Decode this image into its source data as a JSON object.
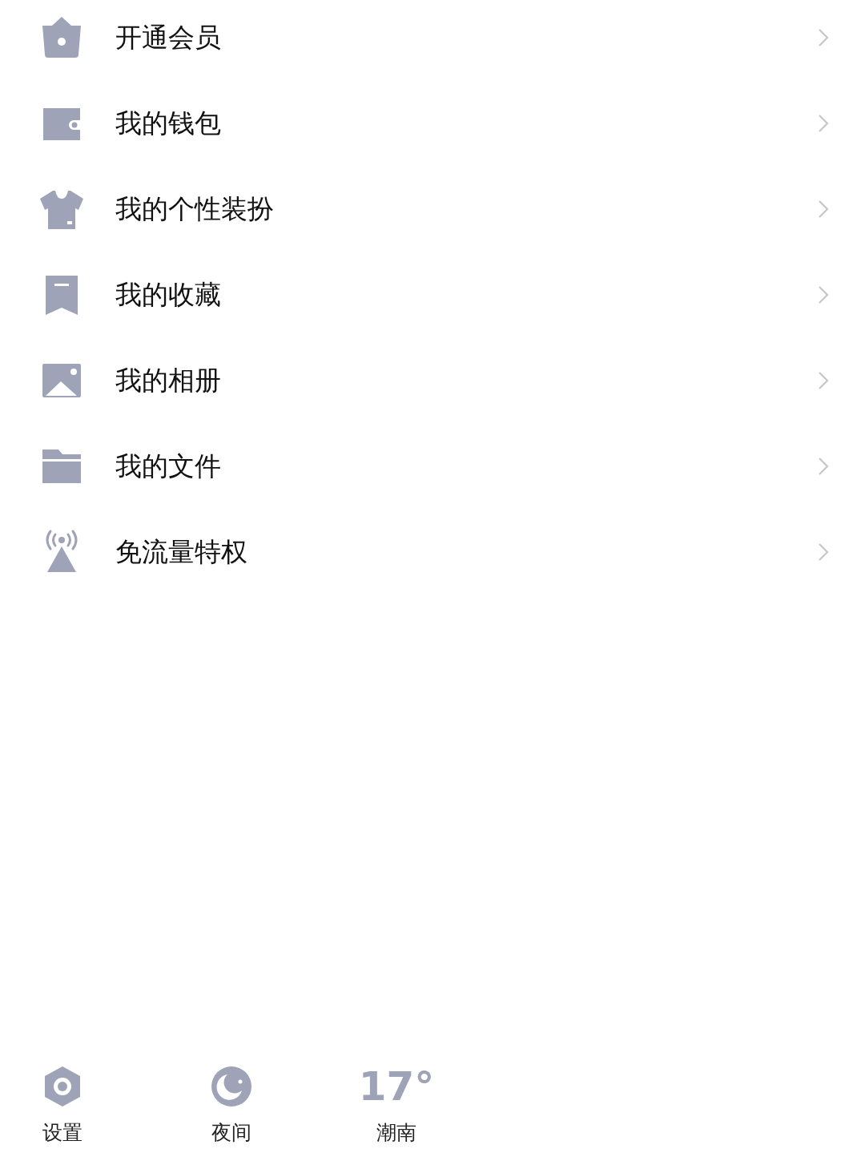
{
  "menu": {
    "items": [
      {
        "kind": "crown",
        "label": "开通会员"
      },
      {
        "kind": "wallet",
        "label": "我的钱包"
      },
      {
        "kind": "shirt",
        "label": "我的个性装扮"
      },
      {
        "kind": "bookmark",
        "label": "我的收藏"
      },
      {
        "kind": "photo",
        "label": "我的相册"
      },
      {
        "kind": "folder",
        "label": "我的文件"
      },
      {
        "kind": "signal",
        "label": "免流量特权"
      }
    ]
  },
  "bottom_bar": {
    "items": [
      {
        "kind": "settings",
        "label": "设置"
      },
      {
        "kind": "night",
        "label": "夜间"
      },
      {
        "kind": "weather",
        "temperature": "17°",
        "label": "潮南"
      }
    ]
  }
}
